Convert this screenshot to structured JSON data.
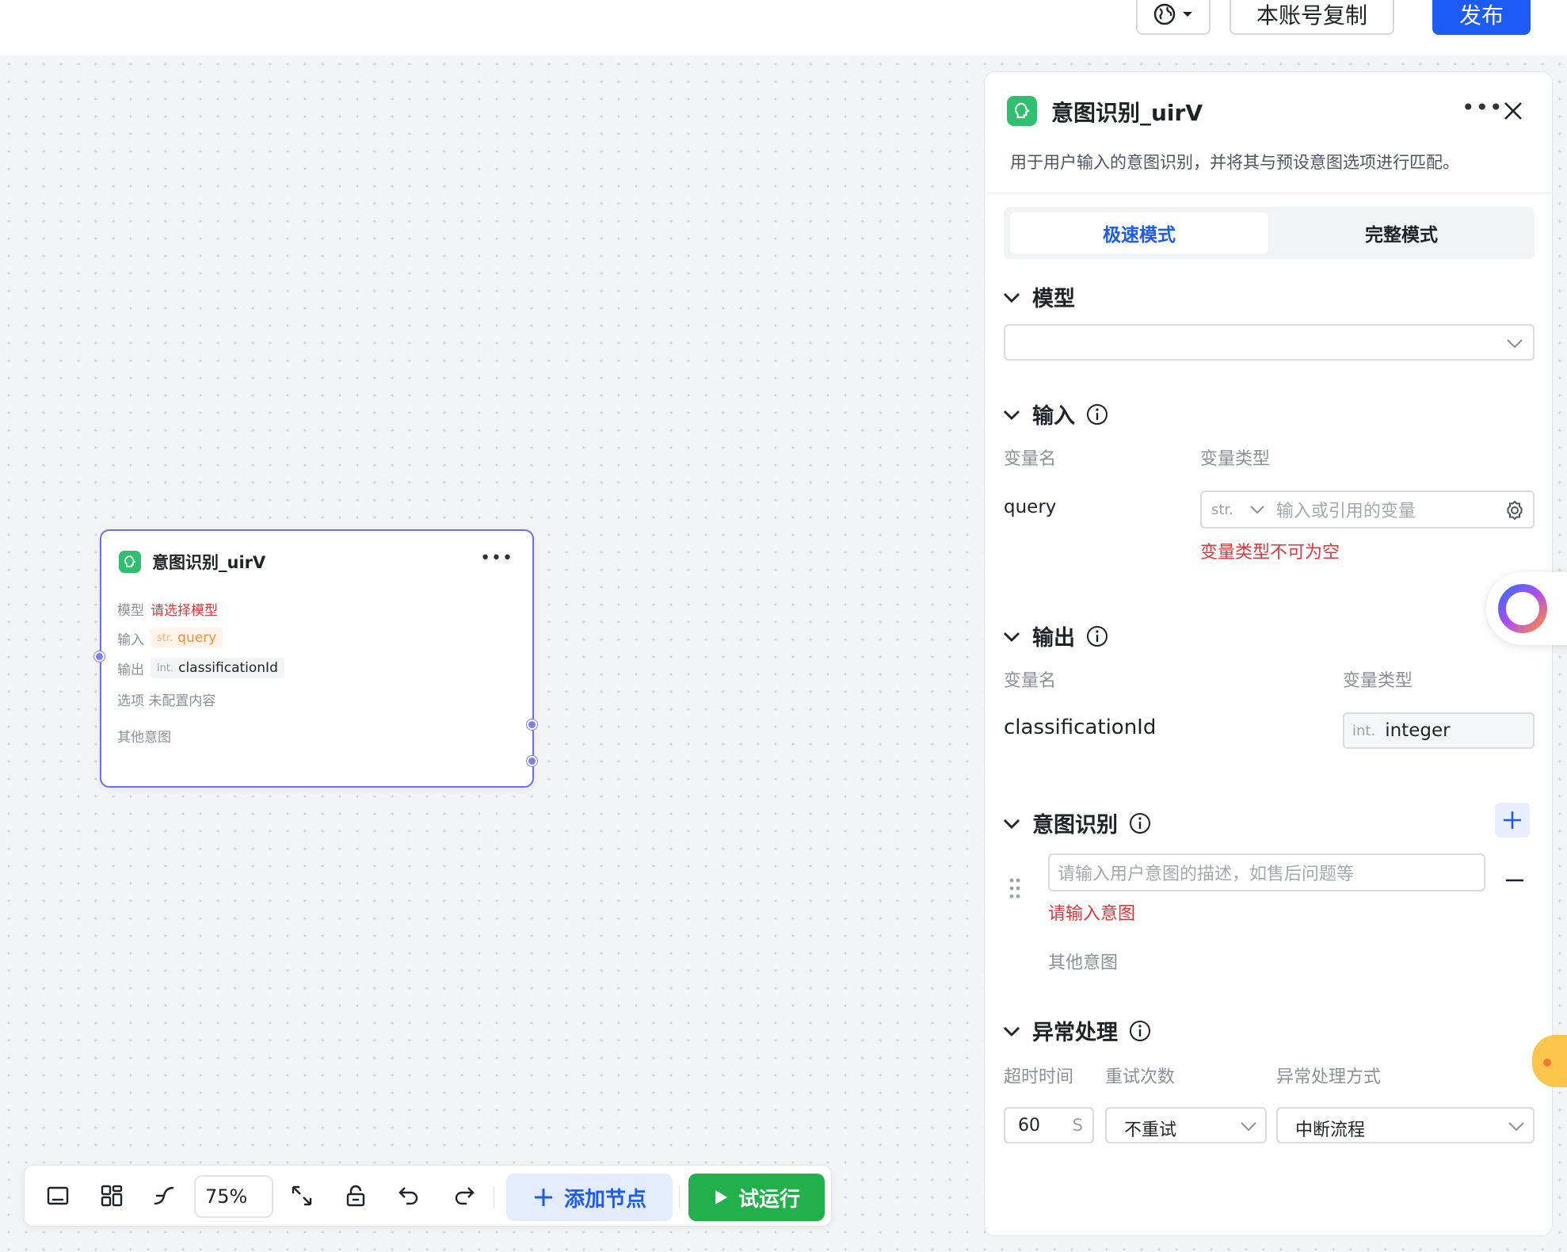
{
  "topbar": {
    "copy_label": "本账号复制",
    "publish_label": "发布"
  },
  "node": {
    "title": "意图识别_uirV",
    "model_label": "模型",
    "model_value": "请选择模型",
    "input_label": "输入",
    "input_type": "str.",
    "input_value": "query",
    "output_label": "输出",
    "output_type": "int.",
    "output_value": "classificationId",
    "options_text": "选项 未配置内容",
    "other_intent": "其他意图"
  },
  "toolbar": {
    "zoom": "75%",
    "add_node_label": "添加节点",
    "try_run_label": "试运行"
  },
  "panel": {
    "title": "意图识别_uirV",
    "description": "用于用户输入的意图识别，并将其与预设意图选项进行匹配。",
    "tabs": [
      {
        "label": "极速模式",
        "active": true
      },
      {
        "label": "完整模式",
        "active": false
      }
    ],
    "model": {
      "section": "模型",
      "value": ""
    },
    "input": {
      "section": "输入",
      "col_name": "变量名",
      "col_type": "变量类型",
      "var_name": "query",
      "type_tag": "str.",
      "placeholder": "输入或引用的变量",
      "error": "变量类型不可为空"
    },
    "output": {
      "section": "输出",
      "col_name": "变量名",
      "col_type": "变量类型",
      "var_name": "classificationId",
      "type_tag": "int.",
      "type_value": "integer"
    },
    "intent": {
      "section": "意图识别",
      "placeholder": "请输入用户意图的描述，如售后问题等",
      "error": "请输入意图",
      "other": "其他意图"
    },
    "exception": {
      "section": "异常处理",
      "col_timeout": "超时时间",
      "col_retry": "重试次数",
      "col_method": "异常处理方式",
      "timeout_value": "60",
      "timeout_unit": "S",
      "retry_value": "不重试",
      "method_value": "中断流程"
    }
  }
}
